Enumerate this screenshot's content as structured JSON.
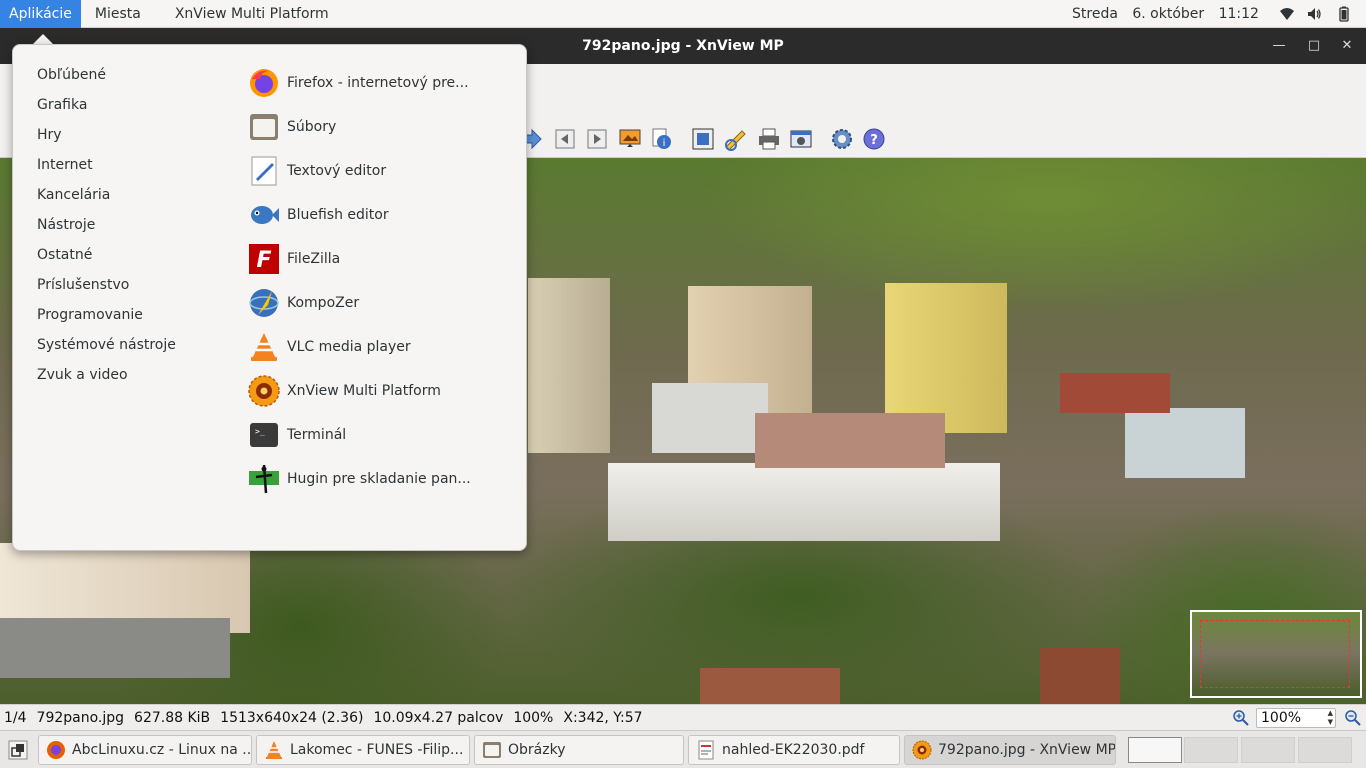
{
  "top_panel": {
    "applications_label": "Aplikácie",
    "places_label": "Miesta",
    "app_name": "XnView Multi Platform",
    "day": "Streda",
    "date": "6. október",
    "time": "11:12",
    "tray_icons": [
      "network-wifi-icon",
      "volume-icon",
      "battery-icon"
    ]
  },
  "window": {
    "title": "792pano.jpg - XnView MP",
    "controls": [
      "minimize",
      "maximize",
      "close"
    ]
  },
  "app_menu": {
    "categories": [
      "Obľúbené",
      "Grafika",
      "Hry",
      "Internet",
      "Kancelária",
      "Nástroje",
      "Ostatné",
      "Príslušenstvo",
      "Programovanie",
      "Systémové nástroje",
      "Zvuk a video"
    ],
    "apps": [
      {
        "label": "Firefox - internetový pre...",
        "icon": "firefox-icon"
      },
      {
        "label": "Súbory",
        "icon": "files-icon"
      },
      {
        "label": "Textový editor",
        "icon": "text-editor-icon"
      },
      {
        "label": "Bluefish editor",
        "icon": "bluefish-icon"
      },
      {
        "label": "FileZilla",
        "icon": "filezilla-icon"
      },
      {
        "label": "KompoZer",
        "icon": "kompozer-icon"
      },
      {
        "label": "VLC media player",
        "icon": "vlc-icon"
      },
      {
        "label": "XnView Multi Platform",
        "icon": "xnview-icon"
      },
      {
        "label": "Terminál",
        "icon": "terminal-icon"
      },
      {
        "label": "Hugin pre skladanie pan...",
        "icon": "hugin-icon"
      }
    ]
  },
  "toolbar": {
    "icons": [
      "next-icon",
      "first-page-icon",
      "last-page-icon",
      "slideshow-icon",
      "info-icon",
      "fullscreen-icon",
      "edit-icon",
      "print-icon",
      "capture-icon",
      "settings-icon",
      "help-icon"
    ]
  },
  "status": {
    "index": "1/4",
    "filename": "792pano.jpg",
    "filesize": "627.88 KiB",
    "dimensions": "1513x640x24 (2.36)",
    "print_size": "10.09x4.27 palcov",
    "zoom_pct": "100%",
    "coords": "X:342, Y:57",
    "zoom_value": "100%"
  },
  "taskbar": {
    "tasks": [
      {
        "label": "AbcLinuxu.cz - Linux na ...",
        "icon": "firefox-icon"
      },
      {
        "label": "Lakomec - FUNES -Filip...",
        "icon": "vlc-icon"
      },
      {
        "label": "Obrázky",
        "icon": "files-icon"
      },
      {
        "label": "nahled-EK22030.pdf",
        "icon": "pdf-icon"
      },
      {
        "label": "792pano.jpg - XnView MP",
        "icon": "xnview-icon"
      }
    ],
    "workspaces": 4,
    "active_workspace": 1
  }
}
